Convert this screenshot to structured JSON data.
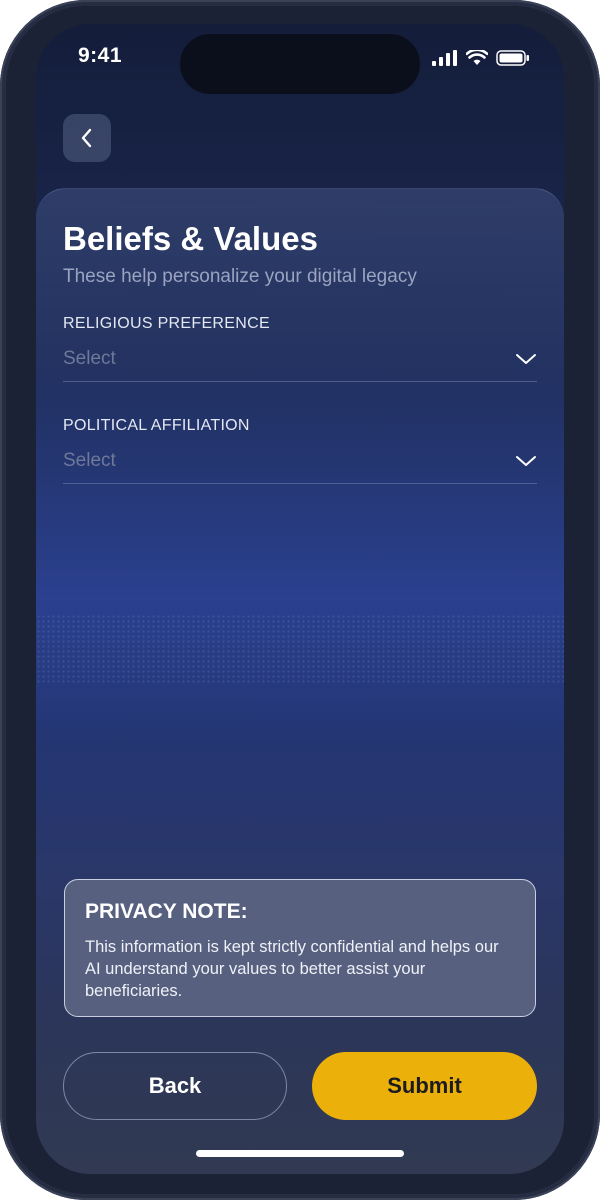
{
  "status": {
    "time": "9:41"
  },
  "header": {
    "back_icon": "chevron-left-icon"
  },
  "form": {
    "title": "Beliefs & Values",
    "subtitle": "These help personalize your digital legacy",
    "fields": [
      {
        "label": "RELIGIOUS PREFERENCE",
        "placeholder": "Select",
        "icon": "chevron-down-icon"
      },
      {
        "label": "POLITICAL AFFILIATION",
        "placeholder": "Select",
        "icon": "chevron-down-icon"
      }
    ]
  },
  "privacy": {
    "title": "PRIVACY NOTE:",
    "text": "This information is kept strictly confidential and helps our AI understand your values to better assist your beneficiaries."
  },
  "actions": {
    "back_label": "Back",
    "submit_label": "Submit"
  },
  "colors": {
    "accent": "#ECB00A",
    "background": "#1C2A55"
  }
}
